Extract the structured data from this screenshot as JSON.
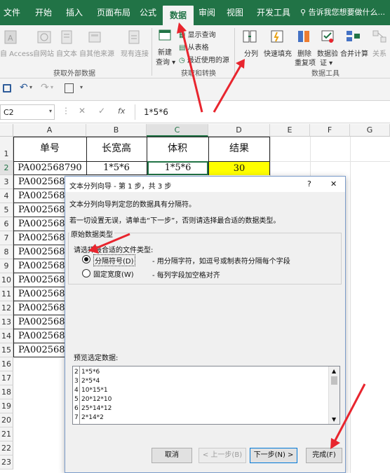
{
  "ribbon": {
    "tabs": [
      "文件",
      "开始",
      "插入",
      "页面布局",
      "公式",
      "数据",
      "审阅",
      "视图",
      "开发工具"
    ],
    "active_tab": "数据",
    "tell_me": "告诉我您想要做什么...",
    "get_external": {
      "items": [
        "自 Access",
        "自网站",
        "自文本",
        "自其他来源",
        "现有连接"
      ],
      "label": "获取外部数据"
    },
    "get_transform": {
      "new_query": "新建",
      "new_query_2": "查询",
      "show_query": "显示查询",
      "from_table": "从表格",
      "recent_sources": "最近使用的源",
      "label": "获取和转换"
    },
    "data_tools": {
      "text_to_columns": "分列",
      "flash_fill": "快速填充",
      "remove_dup_1": "删除",
      "remove_dup_2": "重复项",
      "validation_1": "数据验",
      "validation_2": "证",
      "consolidate": "合并计算",
      "relations": "关系",
      "label": "数据工具"
    },
    "accent": "#217346"
  },
  "formula_bar": {
    "name_box": "C2",
    "formula": "1*5*6"
  },
  "sheet": {
    "columns": [
      "A",
      "B",
      "C",
      "D",
      "E",
      "F",
      "G"
    ],
    "rows": [
      "1",
      "2",
      "3",
      "4",
      "5",
      "6",
      "7",
      "8",
      "9",
      "10",
      "11",
      "12",
      "13",
      "14",
      "15",
      "16",
      "17",
      "18",
      "19",
      "20",
      "21",
      "22",
      "23"
    ],
    "headers": [
      "单号",
      "长宽高",
      "体积",
      "结果"
    ],
    "row2": {
      "a": "PA002568790",
      "b": "1*5*6",
      "c": "1*5*6",
      "d": "30"
    },
    "a_partial": [
      "PA002568",
      "PA002568",
      "PA002568",
      "PA002568",
      "PA002568",
      "PA002568",
      "PA002568",
      "PA002568",
      "PA002568",
      "PA002568",
      "PA002568",
      "PA002568",
      "PA002568"
    ],
    "highlight_color": "#ffff00"
  },
  "dialog": {
    "title": "文本分列向导 - 第 1 步，共 3 步",
    "help": "?",
    "close": "✕",
    "intro": "文本分列向导判定您的数据具有分隔符。",
    "hint": "若一切设置无误，请单击“下一步”，否则请选择最合适的数据类型。",
    "section": "原始数据类型",
    "choose_label": "请选择最合适的文件类型:",
    "option1": "分隔符号(D)",
    "option1_desc": "- 用分隔字符，如逗号或制表符分隔每个字段",
    "option2": "固定宽度(W)",
    "option2_desc": "- 每列字段加空格对齐",
    "preview_label": "预览选定数据:",
    "preview_rows": [
      {
        "n": "2",
        "t": "1*5*6"
      },
      {
        "n": "3",
        "t": "2*5*4"
      },
      {
        "n": "4",
        "t": "10*15*1"
      },
      {
        "n": "5",
        "t": "20*12*10"
      },
      {
        "n": "6",
        "t": "25*14*12"
      },
      {
        "n": "7",
        "t": "2*14*2"
      }
    ],
    "buttons": {
      "cancel": "取消",
      "back": "< 上一步(B)",
      "next": "下一步(N) >",
      "finish": "完成(F)"
    }
  }
}
